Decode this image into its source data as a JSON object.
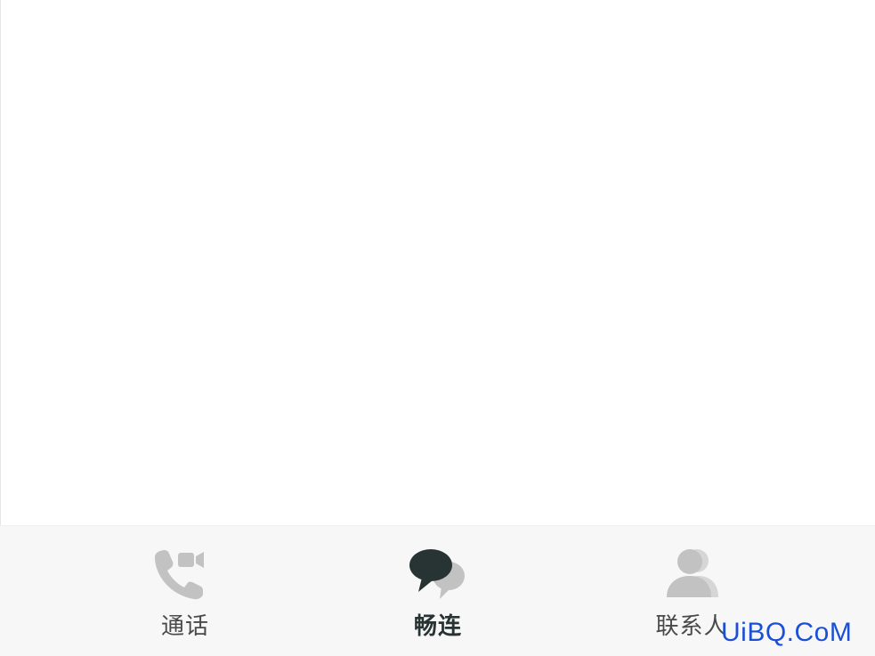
{
  "bottom_nav": {
    "tabs": [
      {
        "id": "calls",
        "label": "通话",
        "icon": "phone-video-icon",
        "active": false
      },
      {
        "id": "chat",
        "label": "畅连",
        "icon": "chat-bubbles-icon",
        "active": true
      },
      {
        "id": "contacts",
        "label": "联系人",
        "icon": "contacts-icon",
        "active": false
      }
    ]
  },
  "watermark": {
    "text": "UiBQ.CoM"
  },
  "colors": {
    "active": "#283433",
    "inactive_icon": "#c2c2c2",
    "inactive_label": "#4a4a4a",
    "watermark": "#1a4fd6",
    "nav_background": "#f7f7f7"
  }
}
